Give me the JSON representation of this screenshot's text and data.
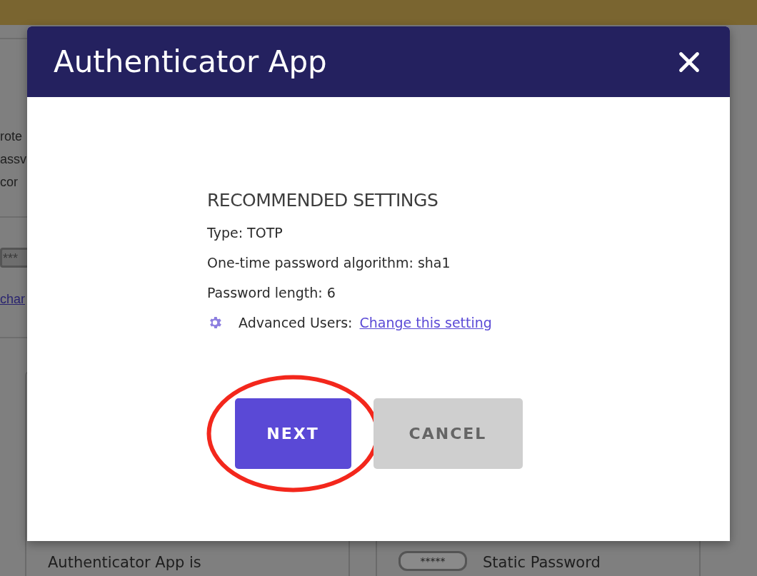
{
  "background": {
    "intro_lines": [
      "rote",
      "assv",
      "cor"
    ],
    "password_field": "***",
    "link": "char",
    "cards": [
      {
        "text": "Authenticator App is"
      },
      {
        "field": "*****",
        "text": "Static Password"
      }
    ]
  },
  "modal": {
    "title": "Authenticator App",
    "heading": "RECOMMENDED SETTINGS",
    "settings": [
      "Type: TOTP",
      "One-time password algorithm: sha1",
      "Password length: 6"
    ],
    "advanced": {
      "label": "Advanced Users:",
      "link": "Change this setting"
    },
    "buttons": [
      {
        "label": "NEXT",
        "kind": "primary",
        "highlighted": true
      },
      {
        "label": "CANCEL",
        "kind": "secondary",
        "highlighted": false
      }
    ]
  }
}
